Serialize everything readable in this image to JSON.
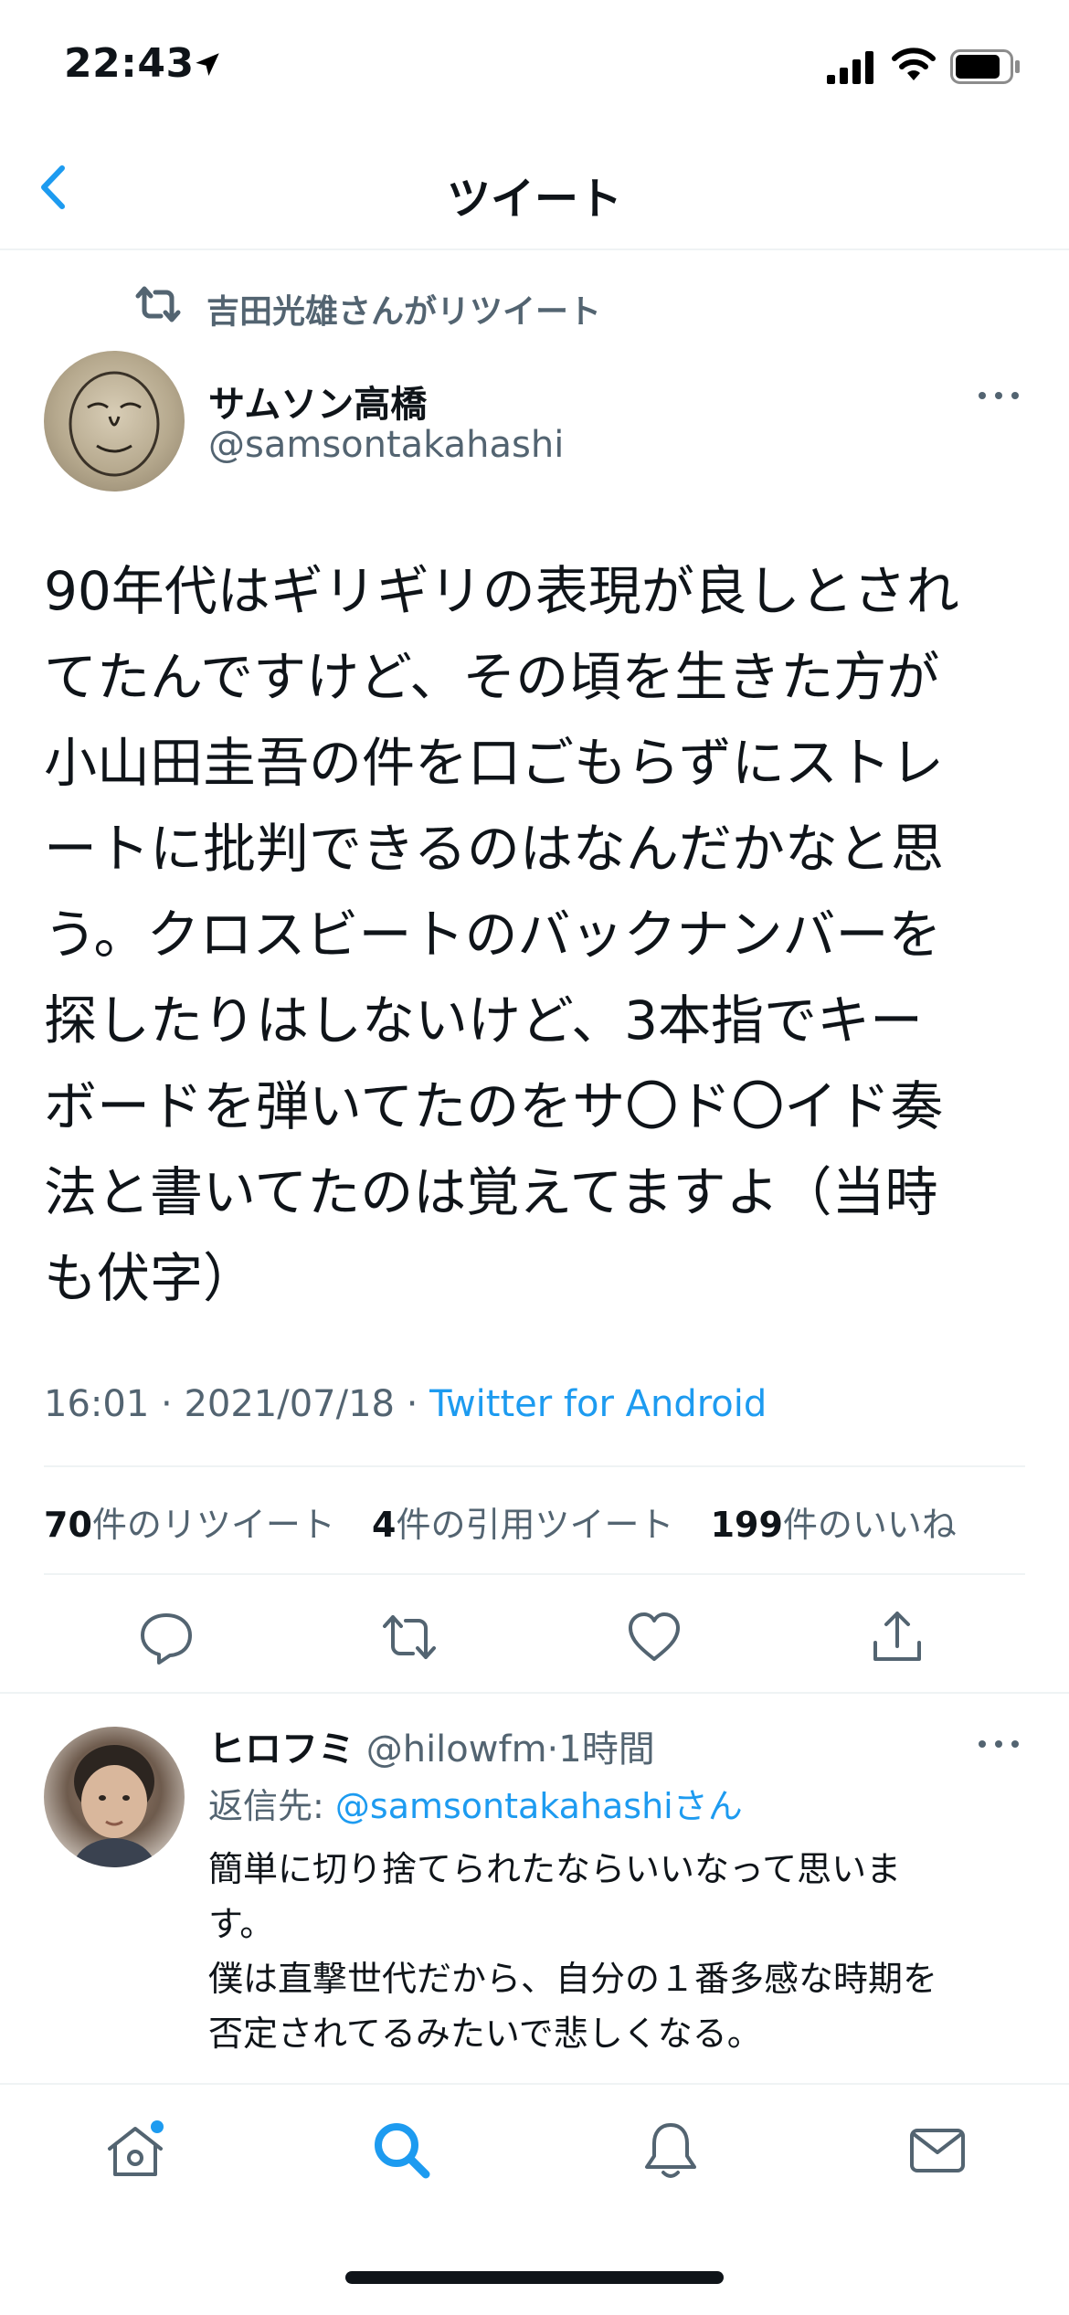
{
  "status_bar": {
    "time": "22:43"
  },
  "nav": {
    "title": "ツイート"
  },
  "retweet": {
    "label": "吉田光雄さんがリツイート"
  },
  "tweet": {
    "author_name": "サムソン高橋",
    "author_handle": "@samsontakahashi",
    "body": "90年代はギリギリの表現が良しとされ\nてたんですけど、その頃を生きた方が\n小山田圭吾の件を口ごもらずにストレ\nートに批判できるのはなんだかなと思\nう。クロスビートのバックナンバーを\n探したりはしないけど、3本指でキー\nボードを弾いてたのをサ〇ド〇イド奏\n法と書いてたのは覚えてますよ（当時\nも伏字）",
    "time": "16:01",
    "date": "2021/07/18",
    "source": "Twitter for Android",
    "retweets_count": "70",
    "retweets_label": "件のリツイート",
    "quotes_count": "4",
    "quotes_label": "件の引用ツイート",
    "likes_count": "199",
    "likes_label": "件のいいね"
  },
  "reply": {
    "name": "ヒロフミ",
    "handle": "@hilowfm",
    "time": "1時間",
    "reply_to_prefix": "返信先: ",
    "reply_to_mention": "@samsontakahashi",
    "reply_to_suffix": "さん",
    "body": "簡単に切り捨てられたならいいなって思いま\nす。\n僕は直撃世代だから、自分の１番多感な時期を\n否定されてるみたいで悲しくなる。"
  },
  "colors": {
    "accent": "#1d9bf0",
    "text": "#0f1419",
    "secondary": "#536471",
    "divider": "#eff3f4"
  },
  "icons": [
    "location-icon",
    "signal-icon",
    "wifi-icon",
    "battery-icon",
    "back-chevron-icon",
    "retweet-icon",
    "more-icon",
    "reply-icon",
    "like-icon",
    "share-icon",
    "home-icon",
    "search-icon",
    "notifications-icon",
    "messages-icon"
  ]
}
